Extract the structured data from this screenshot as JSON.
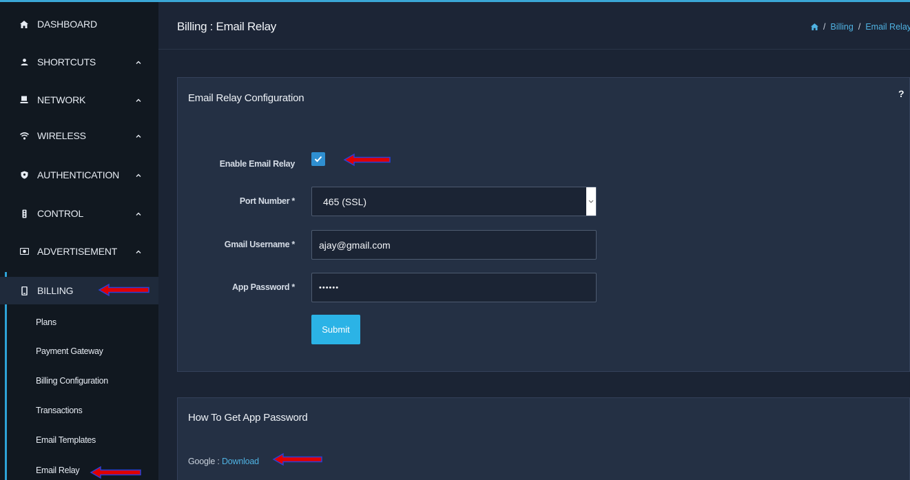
{
  "header": {
    "title": "Billing : Email Relay",
    "breadcrumb": [
      "Billing",
      "Email Relay"
    ]
  },
  "sidebar": {
    "items": [
      {
        "label": "DASHBOARD",
        "icon": "home-icon",
        "has_chevron": false
      },
      {
        "label": "SHORTCUTS",
        "icon": "user-icon",
        "has_chevron": true
      },
      {
        "label": "NETWORK",
        "icon": "monitor-icon",
        "has_chevron": true
      },
      {
        "label": "WIRELESS",
        "icon": "wifi-icon",
        "has_chevron": true
      },
      {
        "label": "AUTHENTICATION",
        "icon": "shield-icon",
        "has_chevron": true
      },
      {
        "label": "CONTROL",
        "icon": "traffic-light-icon",
        "has_chevron": true
      },
      {
        "label": "ADVERTISEMENT",
        "icon": "camera-icon",
        "has_chevron": true
      },
      {
        "label": "BILLING",
        "icon": "mobile-icon",
        "has_chevron": false,
        "active": true
      }
    ],
    "billing_subitems": [
      "Plans",
      "Payment Gateway",
      "Billing Configuration",
      "Transactions",
      "Email Templates",
      "Email Relay"
    ]
  },
  "config_panel": {
    "title": "Email Relay Configuration",
    "help": "?",
    "enable_label": "Enable Email Relay",
    "enable_checked": true,
    "port_label": "Port Number *",
    "port_value": "465 (SSL)",
    "username_label": "Gmail Username *",
    "username_value": "ajay@gmail.com",
    "password_label": "App Password *",
    "password_value": "••••••",
    "submit_label": "Submit"
  },
  "help_panel": {
    "title": "How To Get App Password",
    "google_prefix": "Google : ",
    "download_label": "Download"
  },
  "colors": {
    "accent": "#2bb3e6",
    "sidebar_bg": "#111820",
    "panel_bg": "#243044",
    "arrow_red": "#e00000",
    "arrow_outline": "#2b3fd6"
  }
}
